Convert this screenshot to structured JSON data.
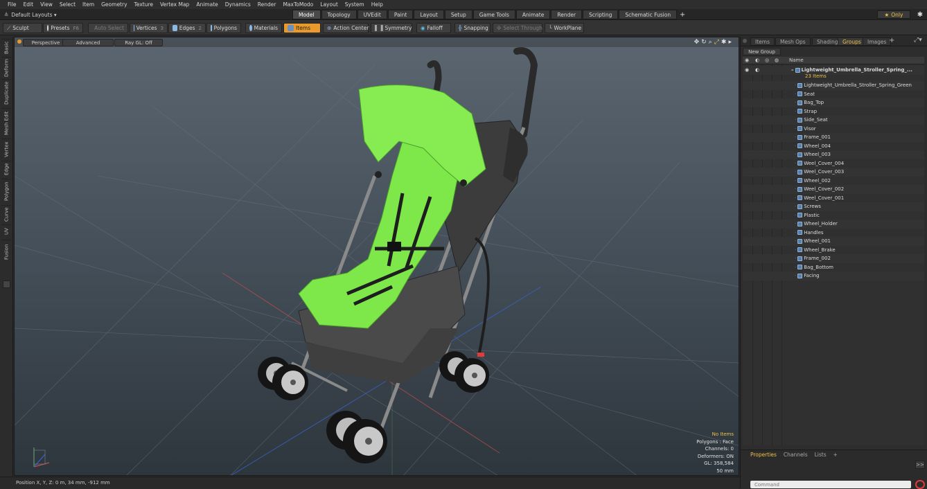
{
  "menubar": {
    "items": [
      "File",
      "Edit",
      "View",
      "Select",
      "Item",
      "Geometry",
      "Texture",
      "Vertex Map",
      "Animate",
      "Dynamics",
      "Render",
      "MaxToModo",
      "Layout",
      "System",
      "Help"
    ]
  },
  "layoutbar": {
    "layout_label": "Default Layouts ▾",
    "tabs": [
      "Model",
      "Topology",
      "UVEdit",
      "Paint",
      "Layout",
      "Setup",
      "Game Tools",
      "Animate",
      "Render",
      "Scripting",
      "Schematic Fusion"
    ],
    "active_tab": "Model",
    "only_label": "Only"
  },
  "toolbar": {
    "sculpt": "Sculpt",
    "presets": "Presets",
    "presets_key": "F6",
    "auto_select": "Auto Select",
    "vertices": "Vertices",
    "vertices_count": "3",
    "edges": "Edges",
    "edges_count": "2",
    "polygons": "Polygons",
    "materials": "Materials",
    "items": "Items",
    "action_center": "Action Center",
    "symmetry": "Symmetry",
    "falloff": "Falloff",
    "snapping": "Snapping",
    "select_through": "Select Through",
    "workplane": "WorkPlane"
  },
  "left_tabs": [
    "Basic",
    "Deform",
    "Duplicate",
    "Mesh Edit",
    "Vertex",
    "Edge",
    "Polygon",
    "Curve",
    "UV",
    "Fusion"
  ],
  "viewport": {
    "view_mode": "Perspective",
    "shading": "Advanced",
    "raygl": "Ray GL: Off",
    "hud": {
      "selection": "No Items",
      "polygons": "Polygons : Face",
      "channels": "Channels: 0",
      "deformers": "Deformers: ON",
      "gl": "GL: 358,584",
      "focal": "50 mm"
    }
  },
  "statusbar": {
    "position": "Position X, Y, Z:  0 m, 34 mm, -912 mm"
  },
  "right_panel": {
    "tabs": [
      "Items",
      "Mesh Ops",
      "Shading",
      "Groups",
      "Images"
    ],
    "active_tab": "Groups",
    "new_group": "New Group",
    "name_header": "Name",
    "group_name": "Lightweight_Umbrella_Stroller_Spring_...",
    "group_count": "23 Items",
    "items": [
      "Lightweight_Umbrella_Stroller_Spring_Green",
      "Seat",
      "Bag_Top",
      "Strap",
      "Side_Seat",
      "Visor",
      "Frame_001",
      "Wheel_004",
      "Wheel_003",
      "Weel_Cover_004",
      "Weel_Cover_003",
      "Wheel_002",
      "Weel_Cover_002",
      "Weel_Cover_001",
      "Screws",
      "Plastic",
      "Wheel_Holder",
      "Handles",
      "Wheel_001",
      "Wheel_Brake",
      "Frame_002",
      "Bag_Bottom",
      "Facing"
    ],
    "bottom_tabs": [
      "Properties",
      "Channels",
      "Lists"
    ],
    "bottom_active": "Properties",
    "command_placeholder": "Command"
  },
  "colors": {
    "accent": "#e89a2c",
    "highlight_text": "#f0c24a",
    "seat_green": "#7ee84a",
    "fabric_gray": "#4a4a4a"
  }
}
